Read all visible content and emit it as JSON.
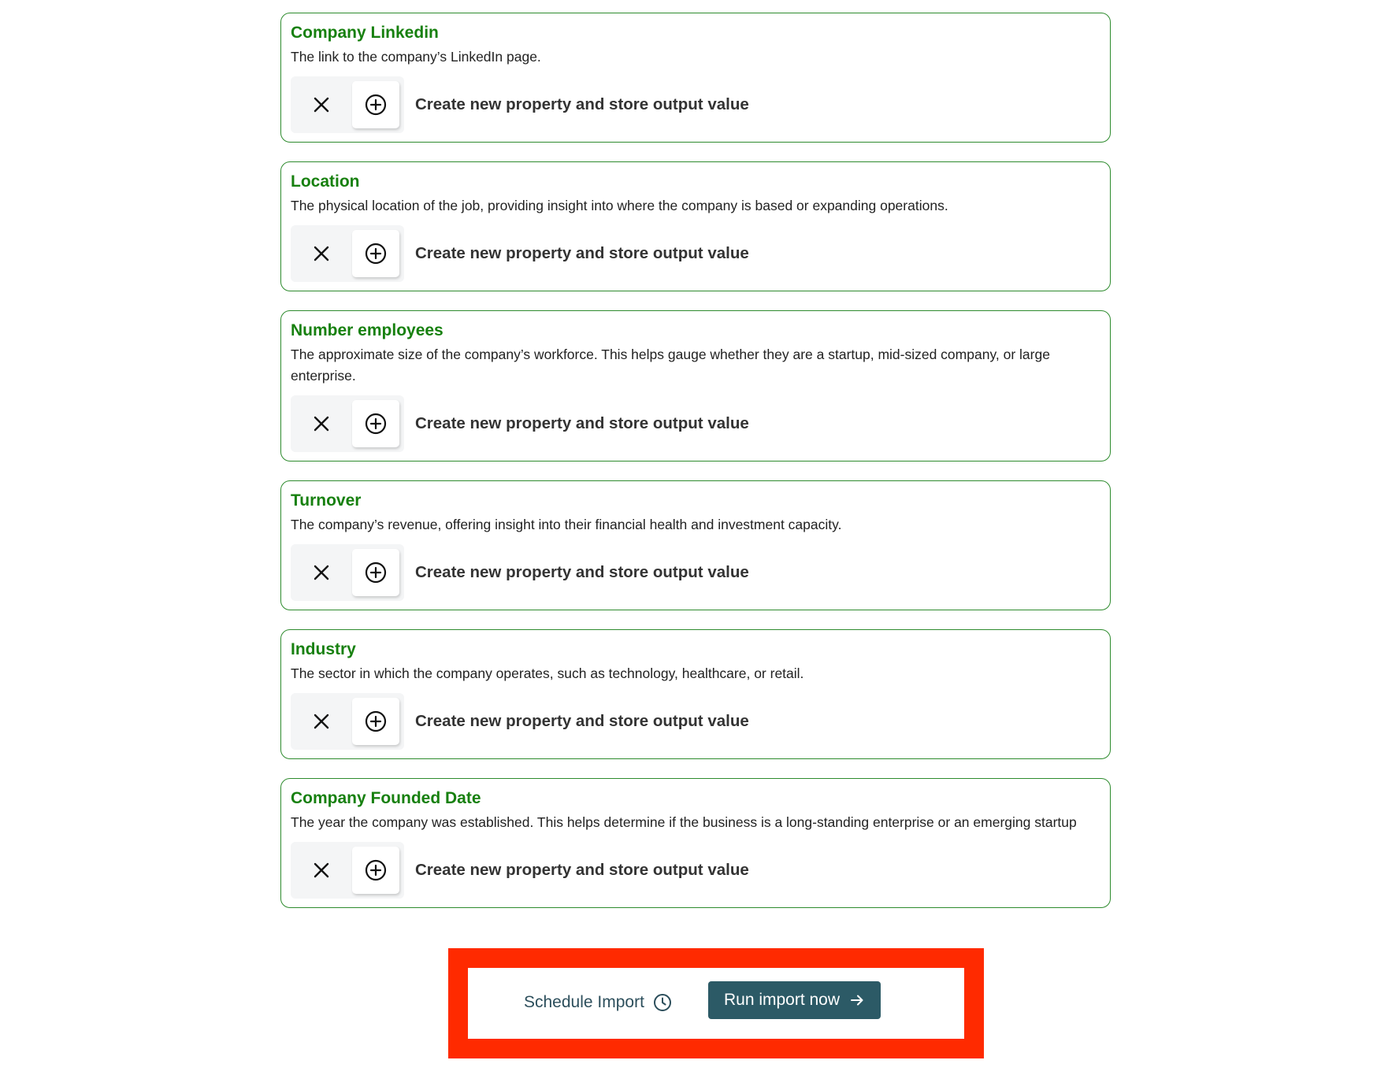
{
  "properties": [
    {
      "title": "Company Linkedin",
      "description": "The link to the company’s LinkedIn page.",
      "action_label": "Create new property and store output value"
    },
    {
      "title": "Location",
      "description": "The physical location of the job, providing insight into where the company is based or expanding operations.",
      "action_label": "Create new property and store output value"
    },
    {
      "title": "Number employees",
      "description": "The approximate size of the company’s workforce. This helps gauge whether they are a startup, mid-sized company, or large enterprise.",
      "action_label": "Create new property and store output value"
    },
    {
      "title": "Turnover",
      "description": "The company’s revenue, offering insight into their financial health and investment capacity.",
      "action_label": "Create new property and store output value"
    },
    {
      "title": "Industry",
      "description": "The sector in which the company operates, such as technology, healthcare, or retail.",
      "action_label": "Create new property and store output value"
    },
    {
      "title": "Company Founded Date",
      "description": "The year the company was established. This helps determine if the business is a long-standing enterprise or an emerging startup",
      "action_label": "Create new property and store output value"
    }
  ],
  "icons": {
    "remove": "close-icon",
    "add": "plus-circle-icon",
    "schedule": "clock-icon",
    "run": "arrow-right-icon"
  },
  "footer": {
    "schedule_label": "Schedule Import",
    "run_label": "Run import now"
  },
  "colors": {
    "title_green": "#17800f",
    "border_green": "#2e8b2e",
    "run_button_bg": "#2c5a66",
    "schedule_text": "#2d4f5c",
    "highlight_red": "#ff2a00"
  }
}
